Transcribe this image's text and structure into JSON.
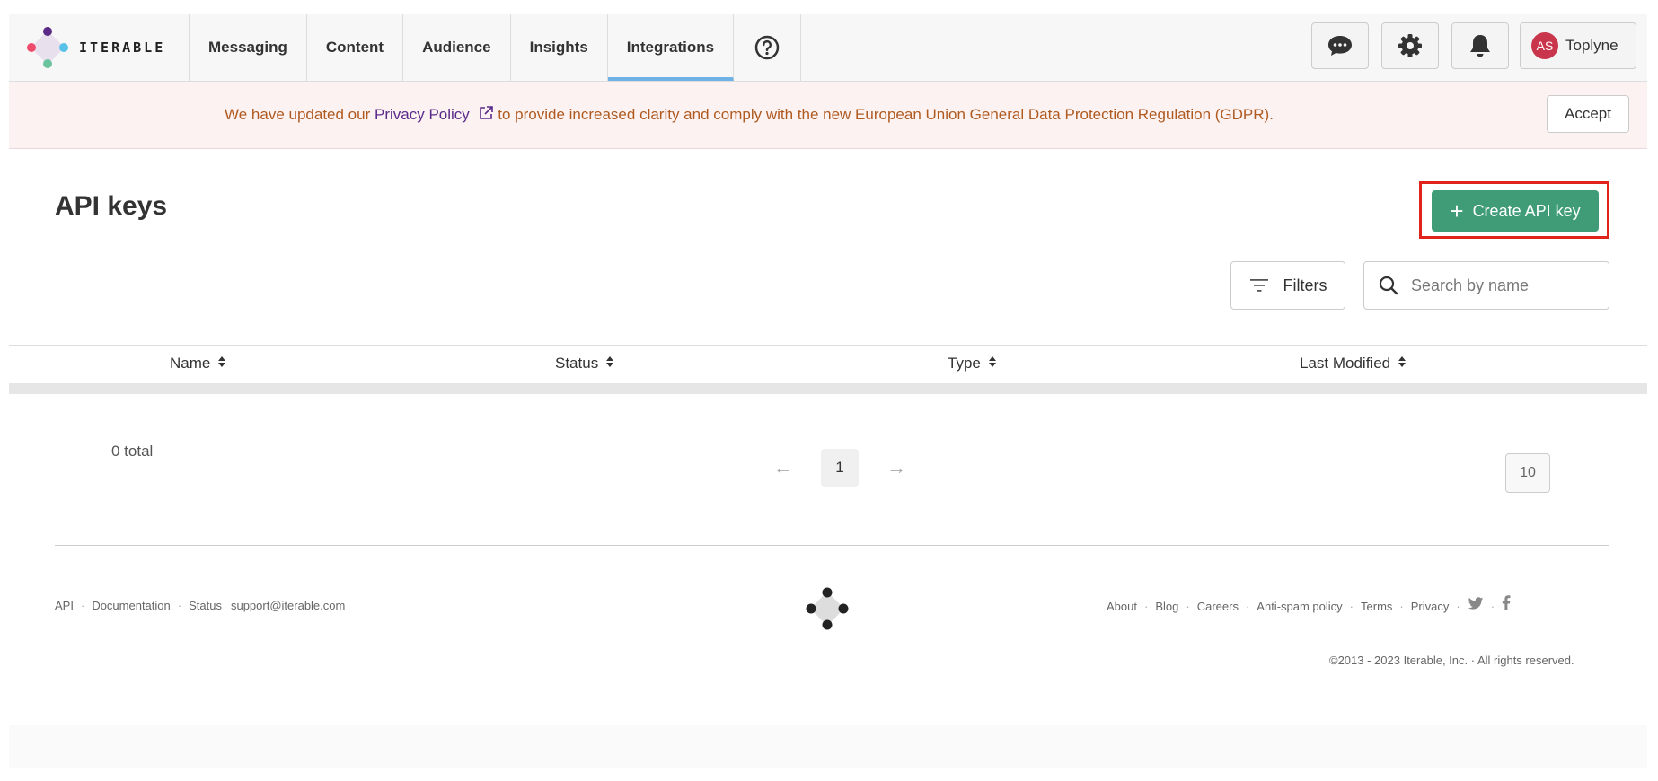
{
  "brand": {
    "name": "ITERABLE"
  },
  "nav": {
    "tabs": [
      "Messaging",
      "Content",
      "Audience",
      "Insights",
      "Integrations"
    ],
    "active_tab": "Integrations",
    "help_icon": "question-circle-icon"
  },
  "toolbar": {
    "chat_icon": "chat-icon",
    "settings_icon": "gear-icon",
    "notifications_icon": "bell-icon",
    "user_initials": "AS",
    "user_name": "Toplyne"
  },
  "banner": {
    "text_before": "We have updated our ",
    "link_text": "Privacy Policy",
    "text_after": " to provide increased clarity and comply with the new European Union General Data Protection Regulation (GDPR).",
    "accept_label": "Accept"
  },
  "page": {
    "title": "API keys",
    "create_label": "Create API key",
    "filters_label": "Filters",
    "search_placeholder": "Search by name"
  },
  "table": {
    "columns": [
      "Name",
      "Status",
      "Type",
      "Last Modified"
    ],
    "rows": [],
    "total_label": "0 total",
    "current_page": "1",
    "page_size": "10",
    "prev_arrow": "←",
    "next_arrow": "→"
  },
  "footer": {
    "left_links": [
      "API",
      "Documentation",
      "Status"
    ],
    "support_email": "support@iterable.com",
    "right_links": [
      "About",
      "Blog",
      "Careers",
      "Anti-spam policy",
      "Terms",
      "Privacy"
    ],
    "social_icons": [
      "twitter-icon",
      "facebook-icon"
    ],
    "copyright": "©2013 - 2023 Iterable, Inc. · All rights reserved."
  },
  "colors": {
    "accent_green": "#3f9c77",
    "active_tab_underline": "#6fb2e6",
    "banner_text": "#b05a20",
    "banner_link": "#5a2a8a",
    "highlight_box": "#e0241b",
    "avatar_bg": "#c9354a"
  }
}
